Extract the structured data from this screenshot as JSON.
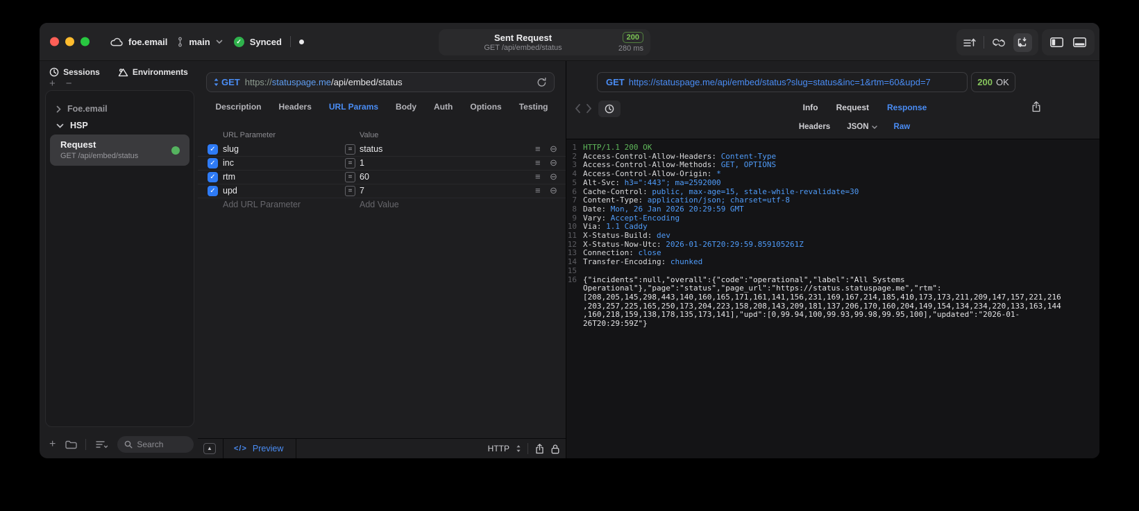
{
  "colors": {
    "accent_blue": "#4a8df5",
    "status_green": "#5fb85a",
    "checkbox_blue": "#2e7bf6"
  },
  "titlebar": {
    "project": "foe.email",
    "branch": "main",
    "sync_status": "Synced",
    "request_title": "Sent Request",
    "request_subtitle": "GET /api/embed/status",
    "status_code": "200",
    "duration": "280 ms"
  },
  "sidebar": {
    "tabs": [
      {
        "label": "Sessions"
      },
      {
        "label": "Environments"
      }
    ],
    "tree": {
      "groups": [
        {
          "label": "Foe.email",
          "expanded": false
        },
        {
          "label": "HSP",
          "expanded": true
        }
      ],
      "selected": {
        "title": "Request",
        "subtitle": "GET /api/embed/status"
      }
    },
    "search_placeholder": "Search"
  },
  "request_pane": {
    "method": "GET",
    "url_scheme": "https://",
    "url_host": "statuspage.me",
    "url_path": "/api/embed/status",
    "tabs": [
      "Description",
      "Headers",
      "URL Params",
      "Body",
      "Auth",
      "Options",
      "Testing"
    ],
    "active_tab": "URL Params",
    "params_table": {
      "columns": [
        "URL Parameter",
        "Value"
      ],
      "rows": [
        {
          "key": "slug",
          "value": "status",
          "checked": true
        },
        {
          "key": "inc",
          "value": "1",
          "checked": true
        },
        {
          "key": "rtm",
          "value": "60",
          "checked": true
        },
        {
          "key": "upd",
          "value": "7",
          "checked": true
        }
      ],
      "add_key_label": "Add URL Parameter",
      "add_value_label": "Add Value"
    },
    "footer": {
      "code_label": "</>",
      "preview_label": "Preview",
      "protocol": "HTTP"
    }
  },
  "response_pane": {
    "method": "GET",
    "url": "https://statuspage.me/api/embed/status?slug=status&inc=1&rtm=60&upd=7",
    "status_code": "200",
    "status_text": "OK",
    "tabs": [
      "Info",
      "Request",
      "Response"
    ],
    "active_tab": "Response",
    "subtabs": [
      {
        "label": "Headers"
      },
      {
        "label": "JSON",
        "dropdown": true
      },
      {
        "label": "Raw"
      }
    ],
    "active_subtab": "Raw",
    "response_lines": [
      {
        "n": "1",
        "parts": [
          {
            "t": "HTTP/1.1 200 OK",
            "c": "status"
          }
        ]
      },
      {
        "n": "2",
        "parts": [
          {
            "t": "Access-Control-Allow-Headers: ",
            "c": "name"
          },
          {
            "t": "Content-Type",
            "c": "val"
          }
        ]
      },
      {
        "n": "3",
        "parts": [
          {
            "t": "Access-Control-Allow-Methods: ",
            "c": "name"
          },
          {
            "t": "GET, OPTIONS",
            "c": "val"
          }
        ]
      },
      {
        "n": "4",
        "parts": [
          {
            "t": "Access-Control-Allow-Origin: ",
            "c": "name"
          },
          {
            "t": "*",
            "c": "val"
          }
        ]
      },
      {
        "n": "5",
        "parts": [
          {
            "t": "Alt-Svc: ",
            "c": "name"
          },
          {
            "t": "h3=\":443\"; ma=2592000",
            "c": "val"
          }
        ]
      },
      {
        "n": "6",
        "parts": [
          {
            "t": "Cache-Control: ",
            "c": "name"
          },
          {
            "t": "public, max-age=15, stale-while-revalidate=30",
            "c": "val"
          }
        ]
      },
      {
        "n": "7",
        "parts": [
          {
            "t": "Content-Type: ",
            "c": "name"
          },
          {
            "t": "application/json; charset=utf-8",
            "c": "val"
          }
        ]
      },
      {
        "n": "8",
        "parts": [
          {
            "t": "Date: ",
            "c": "name"
          },
          {
            "t": "Mon, 26 Jan 2026 20:29:59 GMT",
            "c": "val"
          }
        ]
      },
      {
        "n": "9",
        "parts": [
          {
            "t": "Vary: ",
            "c": "name"
          },
          {
            "t": "Accept-Encoding",
            "c": "val"
          }
        ]
      },
      {
        "n": "10",
        "parts": [
          {
            "t": "Via: ",
            "c": "name"
          },
          {
            "t": "1.1 Caddy",
            "c": "val"
          }
        ]
      },
      {
        "n": "11",
        "parts": [
          {
            "t": "X-Status-Build: ",
            "c": "name"
          },
          {
            "t": "dev",
            "c": "val"
          }
        ]
      },
      {
        "n": "12",
        "parts": [
          {
            "t": "X-Status-Now-Utc: ",
            "c": "name"
          },
          {
            "t": "2026-01-26T20:29:59.859105261Z",
            "c": "val"
          }
        ]
      },
      {
        "n": "13",
        "parts": [
          {
            "t": "Connection: ",
            "c": "name"
          },
          {
            "t": "close",
            "c": "val"
          }
        ]
      },
      {
        "n": "14",
        "parts": [
          {
            "t": "Transfer-Encoding: ",
            "c": "name"
          },
          {
            "t": "chunked",
            "c": "val"
          }
        ]
      },
      {
        "n": "15",
        "parts": []
      },
      {
        "n": "16",
        "parts": [
          {
            "t": "{\"incidents\":null,\"overall\":{\"code\":\"operational\",\"label\":\"All Systems Operational\"},\"page\":\"status\",\"page_url\":\"https://status.statuspage.me\",\"rtm\":[208,205,145,298,443,140,160,165,171,161,141,156,231,169,167,214,185,410,173,173,211,209,147,157,221,216,203,257,225,165,250,173,204,223,158,208,143,209,181,137,206,170,160,204,149,154,134,234,220,133,163,144,160,218,159,138,178,135,173,141],\"upd\":[0,99.94,100,99.93,99.98,99.95,100],\"updated\":\"2026-01-26T20:29:59Z\"}",
            "c": "body"
          }
        ]
      }
    ]
  }
}
